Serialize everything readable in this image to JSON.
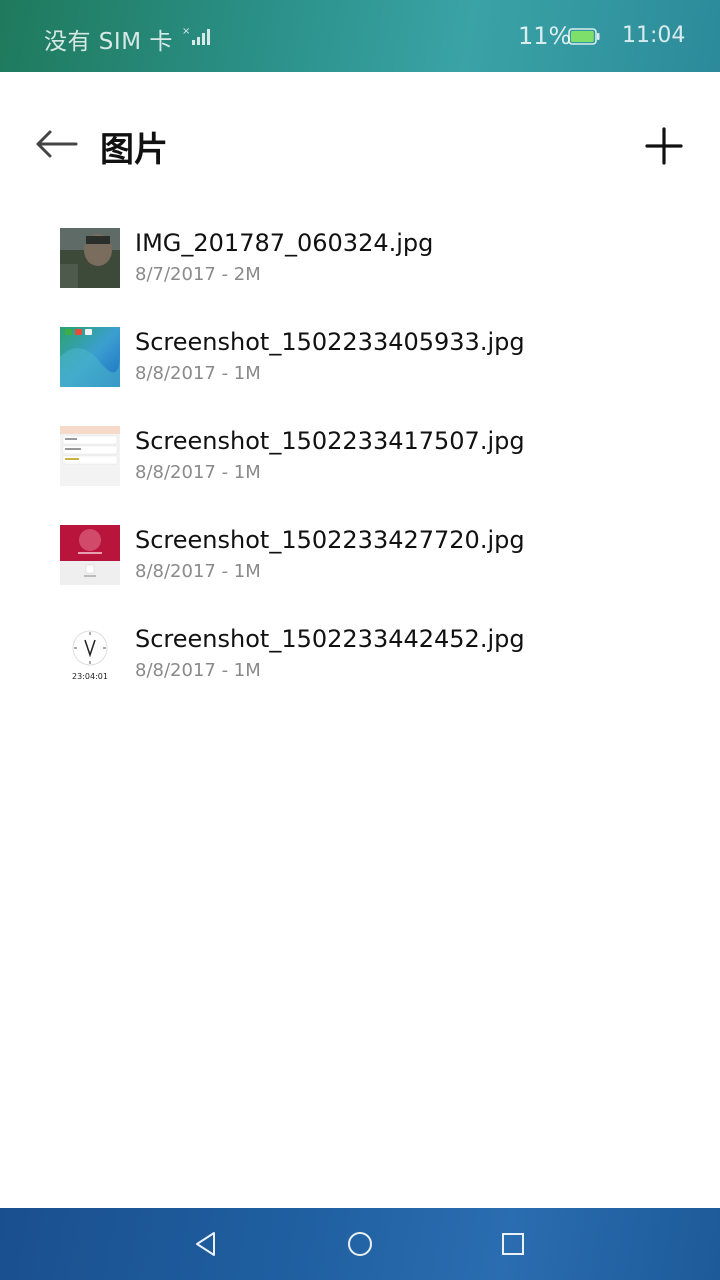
{
  "status_bar": {
    "carrier": "没有 SIM 卡",
    "battery_percent": "11%",
    "battery_level": 0.11,
    "time": "11:04"
  },
  "app_bar": {
    "title": "图片"
  },
  "files": [
    {
      "name": "IMG_201787_060324.jpg",
      "meta": "8/7/2017 - 2M"
    },
    {
      "name": "Screenshot_1502233405933.jpg",
      "meta": "8/8/2017 - 1M"
    },
    {
      "name": "Screenshot_1502233417507.jpg",
      "meta": "8/8/2017 - 1M"
    },
    {
      "name": "Screenshot_1502233427720.jpg",
      "meta": "8/8/2017 - 1M"
    },
    {
      "name": "Screenshot_1502233442452.jpg",
      "meta": "8/8/2017 - 1M",
      "thumb_text": "23:04:01"
    }
  ],
  "nav": {
    "icons": [
      "back-triangle-icon",
      "home-circle-icon",
      "recents-square-icon"
    ]
  },
  "colors": {
    "battery_fill": "#7ee06a",
    "photo_thumb": "#3d4a3a",
    "red_thumb": "#b8143c"
  }
}
